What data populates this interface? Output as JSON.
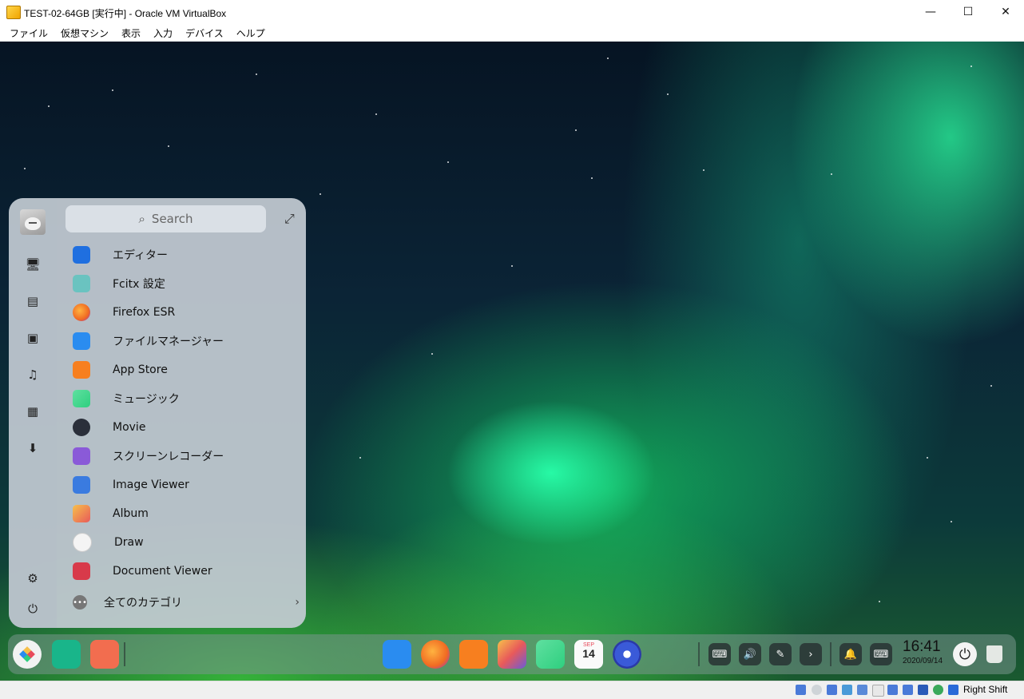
{
  "window": {
    "title": "TEST-02-64GB [実行中] - Oracle VM VirtualBox",
    "minimize": "—",
    "maximize": "☐",
    "close": "✕"
  },
  "menubar": [
    "ファイル",
    "仮想マシン",
    "表示",
    "入力",
    "デバイス",
    "ヘルプ"
  ],
  "launcher": {
    "search_placeholder": "Search",
    "apps": [
      {
        "label": "エディター",
        "icon": "editor-icon",
        "color": "#1f6fe0"
      },
      {
        "label": "Fcitx 設定",
        "icon": "fcitx-settings-icon",
        "color": "#6ac3c0"
      },
      {
        "label": "Firefox ESR",
        "icon": "firefox-icon",
        "color": "#f06a22"
      },
      {
        "label": "ファイルマネージャー",
        "icon": "file-manager-icon",
        "color": "#2a8cf0"
      },
      {
        "label": "App Store",
        "icon": "app-store-icon",
        "color": "#f77f1f"
      },
      {
        "label": "ミュージック",
        "icon": "music-icon",
        "color": "#2fcf7f"
      },
      {
        "label": "Movie",
        "icon": "movie-icon",
        "color": "#2a2f3a"
      },
      {
        "label": "スクリーンレコーダー",
        "icon": "screen-recorder-icon",
        "color": "#8a5ad8"
      },
      {
        "label": "Image Viewer",
        "icon": "image-viewer-icon",
        "color": "#3a7be0"
      },
      {
        "label": "Album",
        "icon": "album-icon",
        "color": "#f0a040"
      },
      {
        "label": "Draw",
        "icon": "draw-icon",
        "color": "#e85a5a"
      },
      {
        "label": "Document Viewer",
        "icon": "document-viewer-icon",
        "color": "#d83a4a"
      }
    ],
    "all_categories": "全てのカテゴリ"
  },
  "dock": {
    "time": "16:41",
    "date": "2020/09/14",
    "calendar_month": "SEP",
    "calendar_day": "14"
  },
  "statusbar": {
    "host_key": "Right Shift"
  }
}
